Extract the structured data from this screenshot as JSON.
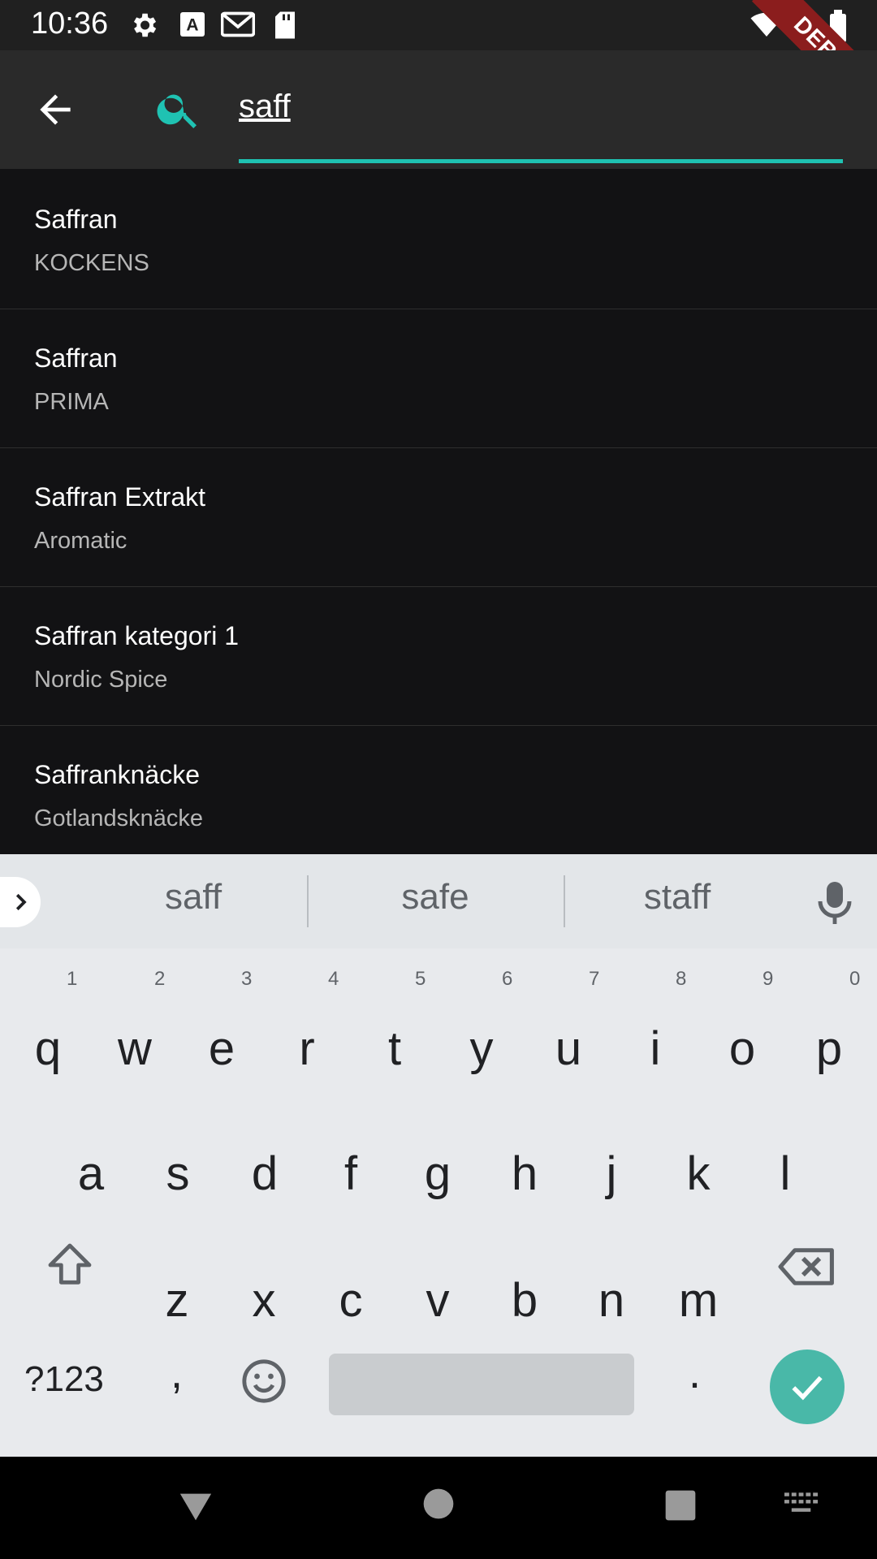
{
  "status_bar": {
    "time": "10:36",
    "icons": [
      "settings-icon",
      "text-a-icon",
      "gmail-icon",
      "sd-card-icon",
      "wifi-icon",
      "cell-signal-icon",
      "battery-icon"
    ],
    "debug_label": "DEBUG"
  },
  "search": {
    "value": "saff",
    "accent_color": "#1fc2b2"
  },
  "results": [
    {
      "title": "Saffran",
      "subtitle": "KOCKENS"
    },
    {
      "title": "Saffran",
      "subtitle": "PRIMA"
    },
    {
      "title": "Saffran Extrakt",
      "subtitle": "Aromatic"
    },
    {
      "title": "Saffran kategori 1",
      "subtitle": "Nordic Spice"
    },
    {
      "title": "Saffranknäcke",
      "subtitle": "Gotlandsknäcke"
    }
  ],
  "keyboard": {
    "suggestions": [
      "saff",
      "safe",
      "staff"
    ],
    "row1": [
      "q",
      "w",
      "e",
      "r",
      "t",
      "y",
      "u",
      "i",
      "o",
      "p"
    ],
    "row1_hints": [
      "1",
      "2",
      "3",
      "4",
      "5",
      "6",
      "7",
      "8",
      "9",
      "0"
    ],
    "row2": [
      "a",
      "s",
      "d",
      "f",
      "g",
      "h",
      "j",
      "k",
      "l"
    ],
    "row3": [
      "z",
      "x",
      "c",
      "v",
      "b",
      "n",
      "m"
    ],
    "symbols_label": "?123",
    "comma": ",",
    "period": "."
  }
}
